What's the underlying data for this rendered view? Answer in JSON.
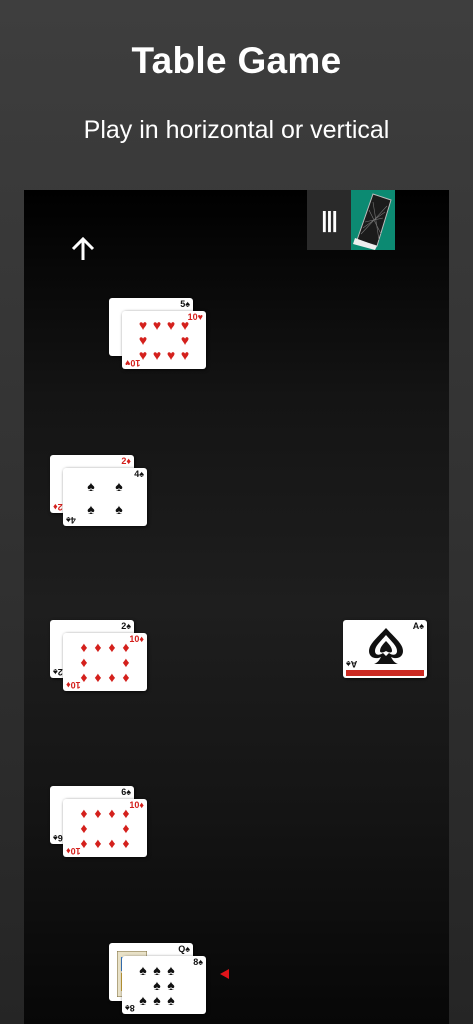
{
  "header": {
    "title": "Table Game",
    "subtitle": "Play in horizontal or vertical"
  },
  "toolbar": {
    "menu_glyph": "|||"
  },
  "icons": {
    "back": "up-arrow-icon",
    "menu": "menu-icon",
    "deck": "card-deck-icon",
    "turn": "turn-indicator-icon"
  },
  "colors": {
    "deck_bg": "#0c8a72",
    "red_suit": "#d4201c",
    "indicator": "#e0141a"
  },
  "piles": [
    {
      "under": {
        "rank": "5",
        "suit": "♠"
      },
      "top": {
        "rank": "10",
        "suit": "♥"
      }
    },
    {
      "under": {
        "rank": "2",
        "suit": "♦"
      },
      "top": {
        "rank": "4",
        "suit": "♠"
      }
    },
    {
      "under": {
        "rank": "2",
        "suit": "♠"
      },
      "top": {
        "rank": "10",
        "suit": "♦"
      }
    },
    {
      "under": {
        "rank": "6",
        "suit": "♠"
      },
      "top": {
        "rank": "10",
        "suit": "♦"
      }
    },
    {
      "under": {
        "rank": "Q",
        "suit": "♠"
      },
      "top": {
        "rank": "8",
        "suit": "♠"
      }
    }
  ],
  "single_card": {
    "rank": "A",
    "suit": "♠"
  }
}
